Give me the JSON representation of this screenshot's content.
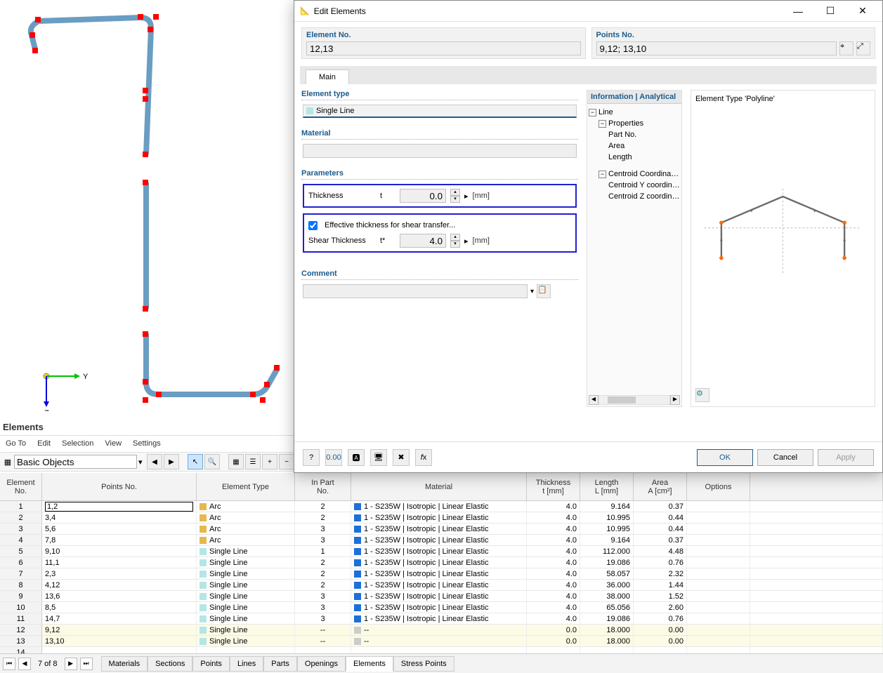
{
  "panel": {
    "title": "Elements"
  },
  "menu": {
    "goto": "Go To",
    "edit": "Edit",
    "selection": "Selection",
    "view": "View",
    "settings": "Settings"
  },
  "toolbar": {
    "combo": "Basic Objects"
  },
  "grid": {
    "headers": {
      "elno": "Element\nNo.",
      "points": "Points No.",
      "etype": "Element Type",
      "inpart": "In Part\nNo.",
      "material": "Material",
      "thickness": "Thickness\nt [mm]",
      "length": "Length\nL [mm]",
      "area": "Area\nA [cm²]",
      "options": "Options"
    },
    "rows": [
      {
        "n": 1,
        "pts": "1,2",
        "et": "Arc",
        "sw": "arc",
        "part": "2",
        "mat": "1 - S235W | Isotropic | Linear Elastic",
        "t": "4.0",
        "l": "9.164",
        "a": "0.37",
        "sel": false,
        "edit": true
      },
      {
        "n": 2,
        "pts": "3,4",
        "et": "Arc",
        "sw": "arc",
        "part": "2",
        "mat": "1 - S235W | Isotropic | Linear Elastic",
        "t": "4.0",
        "l": "10.995",
        "a": "0.44",
        "sel": false
      },
      {
        "n": 3,
        "pts": "5,6",
        "et": "Arc",
        "sw": "arc",
        "part": "3",
        "mat": "1 - S235W | Isotropic | Linear Elastic",
        "t": "4.0",
        "l": "10.995",
        "a": "0.44",
        "sel": false
      },
      {
        "n": 4,
        "pts": "7,8",
        "et": "Arc",
        "sw": "arc",
        "part": "3",
        "mat": "1 - S235W | Isotropic | Linear Elastic",
        "t": "4.0",
        "l": "9.164",
        "a": "0.37",
        "sel": false
      },
      {
        "n": 5,
        "pts": "9,10",
        "et": "Single Line",
        "sw": "line",
        "part": "1",
        "mat": "1 - S235W | Isotropic | Linear Elastic",
        "t": "4.0",
        "l": "112.000",
        "a": "4.48",
        "sel": false
      },
      {
        "n": 6,
        "pts": "11,1",
        "et": "Single Line",
        "sw": "line",
        "part": "2",
        "mat": "1 - S235W | Isotropic | Linear Elastic",
        "t": "4.0",
        "l": "19.086",
        "a": "0.76",
        "sel": false
      },
      {
        "n": 7,
        "pts": "2,3",
        "et": "Single Line",
        "sw": "line",
        "part": "2",
        "mat": "1 - S235W | Isotropic | Linear Elastic",
        "t": "4.0",
        "l": "58.057",
        "a": "2.32",
        "sel": false
      },
      {
        "n": 8,
        "pts": "4,12",
        "et": "Single Line",
        "sw": "line",
        "part": "2",
        "mat": "1 - S235W | Isotropic | Linear Elastic",
        "t": "4.0",
        "l": "36.000",
        "a": "1.44",
        "sel": false
      },
      {
        "n": 9,
        "pts": "13,6",
        "et": "Single Line",
        "sw": "line",
        "part": "3",
        "mat": "1 - S235W | Isotropic | Linear Elastic",
        "t": "4.0",
        "l": "38.000",
        "a": "1.52",
        "sel": false
      },
      {
        "n": 10,
        "pts": "8,5",
        "et": "Single Line",
        "sw": "line",
        "part": "3",
        "mat": "1 - S235W | Isotropic | Linear Elastic",
        "t": "4.0",
        "l": "65.056",
        "a": "2.60",
        "sel": false
      },
      {
        "n": 11,
        "pts": "14,7",
        "et": "Single Line",
        "sw": "line",
        "part": "3",
        "mat": "1 - S235W | Isotropic | Linear Elastic",
        "t": "4.0",
        "l": "19.086",
        "a": "0.76",
        "sel": false
      },
      {
        "n": 12,
        "pts": "9,12",
        "et": "Single Line",
        "sw": "line",
        "part": "--",
        "mat": "--",
        "t": "0.0",
        "l": "18.000",
        "a": "0.00",
        "sel": true,
        "nomat": true
      },
      {
        "n": 13,
        "pts": "13,10",
        "et": "Single Line",
        "sw": "line",
        "part": "--",
        "mat": "--",
        "t": "0.0",
        "l": "18.000",
        "a": "0.00",
        "sel": true,
        "nomat": true
      },
      {
        "n": 14,
        "pts": "",
        "et": "",
        "sw": "",
        "part": "",
        "mat": "",
        "t": "",
        "l": "",
        "a": "",
        "sel": false,
        "empty": true
      }
    ]
  },
  "footer": {
    "page": "7 of 8",
    "tabs": [
      "Materials",
      "Sections",
      "Points",
      "Lines",
      "Parts",
      "Openings",
      "Elements",
      "Stress Points"
    ],
    "active": "Elements"
  },
  "axis": {
    "y": "Y",
    "z": "Z"
  },
  "dialog": {
    "title": "Edit Elements",
    "elno_label": "Element No.",
    "elno_value": "12,13",
    "ptno_label": "Points No.",
    "ptno_value": "9,12; 13,10",
    "tab": "Main",
    "group_eltype": "Element type",
    "eltype_value": "Single Line",
    "group_material": "Material",
    "material_value": "",
    "group_params": "Parameters",
    "thickness_label": "Thickness",
    "thickness_sym": "t",
    "thickness_value": "0.0",
    "unit": "[mm]",
    "eff_chk": "Effective thickness for shear transfer...",
    "shear_label": "Shear Thickness",
    "shear_sym": "t*",
    "shear_value": "4.0",
    "info_header": "Information | Analytical",
    "tree": {
      "line": "Line",
      "props": "Properties",
      "partno": "Part No.",
      "area": "Area",
      "length": "Length",
      "centroid": "Centroid Coordinates",
      "cy": "Centroid Y coordinate",
      "cz": "Centroid Z coordinate"
    },
    "preview_title": "Element Type 'Polyline'",
    "comment": "Comment",
    "buttons": {
      "ok": "OK",
      "cancel": "Cancel",
      "apply": "Apply"
    }
  }
}
